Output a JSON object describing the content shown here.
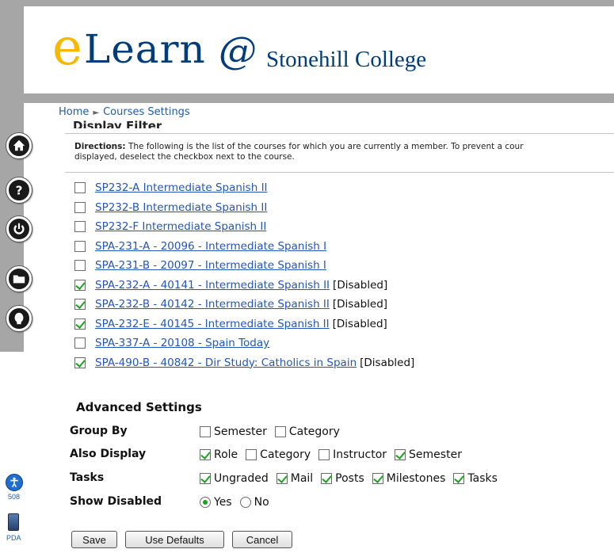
{
  "logo": {
    "e": "e",
    "learn": "Learn",
    "at": "@",
    "college": "Stonehill College"
  },
  "breadcrumb": {
    "home": "Home",
    "separator": "►",
    "current": "Courses Settings"
  },
  "nav_icons": [
    "home-icon",
    "help-icon",
    "power-icon",
    "folder-icon",
    "profile-icon"
  ],
  "display_filter": {
    "heading": "Display Filter",
    "directions_label": "Directions:",
    "directions_line1": "The following is the list of the courses for which you are currently a member. To prevent a cour",
    "directions_line2": "displayed, deselect the checkbox next to the course."
  },
  "courses": [
    {
      "name": "SP232-A Intermediate Spanish II",
      "checked": false,
      "tag": ""
    },
    {
      "name": "SP232-B Intermediate Spanish II",
      "checked": false,
      "tag": ""
    },
    {
      "name": "SP232-F Intermediate Spanish II",
      "checked": false,
      "tag": ""
    },
    {
      "name": "SPA-231-A - 20096 - Intermediate Spanish I",
      "checked": false,
      "tag": ""
    },
    {
      "name": "SPA-231-B - 20097 - Intermediate Spanish I",
      "checked": false,
      "tag": ""
    },
    {
      "name": "SPA-232-A - 40141 - Intermediate Spanish II",
      "checked": true,
      "tag": "[Disabled]"
    },
    {
      "name": "SPA-232-B - 40142 - Intermediate Spanish II",
      "checked": true,
      "tag": "[Disabled]"
    },
    {
      "name": "SPA-232-E - 40145 - Intermediate Spanish II",
      "checked": true,
      "tag": "[Disabled]"
    },
    {
      "name": "SPA-337-A - 20108 - Spain Today",
      "checked": false,
      "tag": ""
    },
    {
      "name": "SPA-490-B - 40842 - Dir Study: Catholics in Spain",
      "checked": true,
      "tag": "[Disabled]"
    }
  ],
  "advanced": {
    "heading": "Advanced Settings",
    "group_by": {
      "label": "Group By",
      "options": [
        {
          "label": "Semester",
          "checked": false
        },
        {
          "label": "Category",
          "checked": false
        }
      ]
    },
    "also_display": {
      "label": "Also Display",
      "options": [
        {
          "label": "Role",
          "checked": true
        },
        {
          "label": "Category",
          "checked": false
        },
        {
          "label": "Instructor",
          "checked": false
        },
        {
          "label": "Semester",
          "checked": true
        }
      ]
    },
    "tasks": {
      "label": "Tasks",
      "options": [
        {
          "label": "Ungraded",
          "checked": true
        },
        {
          "label": "Mail",
          "checked": true
        },
        {
          "label": "Posts",
          "checked": true
        },
        {
          "label": "Milestones",
          "checked": true
        },
        {
          "label": "Tasks",
          "checked": true
        }
      ]
    },
    "show_disabled": {
      "label": "Show Disabled",
      "options": [
        {
          "label": "Yes",
          "selected": true
        },
        {
          "label": "No",
          "selected": false
        }
      ]
    }
  },
  "buttons": {
    "save": "Save",
    "use_defaults": "Use Defaults",
    "cancel": "Cancel"
  },
  "badges": {
    "accessibility": "508",
    "pda": "PDA"
  },
  "colors": {
    "frame": "#a6a6a6",
    "link": "#2456b8",
    "logo_gold": "#f6b800",
    "logo_navy": "#003d7a",
    "check": "#1aa61a"
  }
}
